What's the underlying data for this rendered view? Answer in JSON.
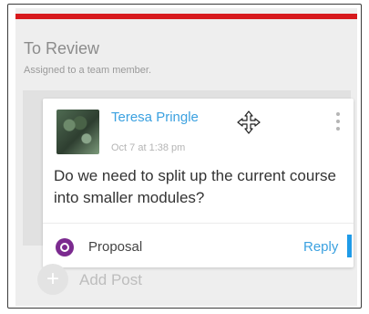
{
  "column": {
    "title": "To Review",
    "subtitle": "Assigned to a team member.",
    "accent_color": "#d7191d"
  },
  "post": {
    "author": "Teresa Pringle",
    "timestamp": "Oct 7 at 1:38 pm",
    "body": "Do we need to split up the current course into smaller modules?",
    "tag": {
      "label": "Proposal",
      "icon": "proposal-icon",
      "color": "#7b2a8f"
    },
    "reply_label": "Reply",
    "icons": {
      "move": "move-icon",
      "more": "more-vertical-icon"
    }
  },
  "add_post": {
    "label": "Add Post",
    "icon": "plus-icon"
  }
}
